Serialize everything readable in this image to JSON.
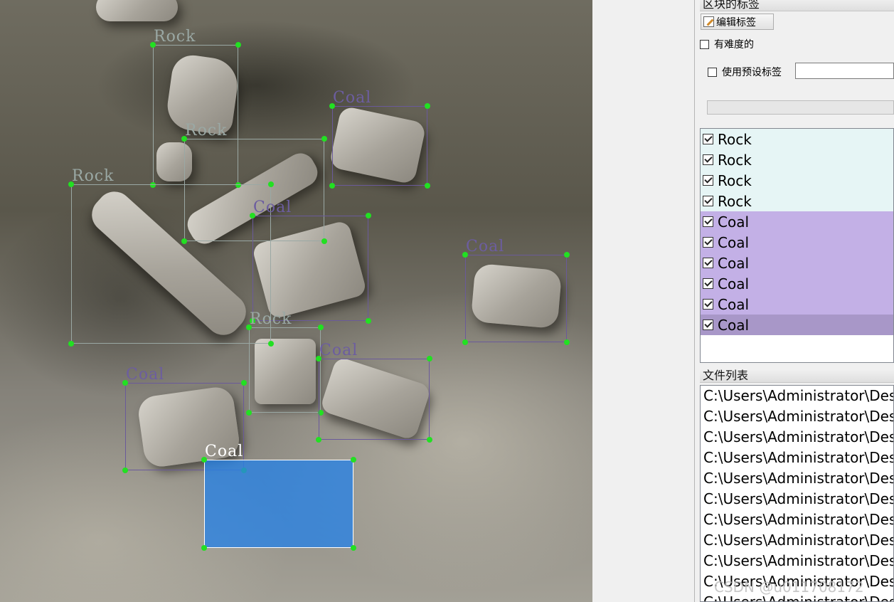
{
  "canvas": {
    "annotations": [
      {
        "label": "Rock",
        "kind": "rock",
        "selected": false
      },
      {
        "label": "Coal",
        "kind": "coal",
        "selected": false
      },
      {
        "label": "Rock",
        "kind": "rock",
        "selected": false
      },
      {
        "label": "Rock",
        "kind": "rock",
        "selected": false
      },
      {
        "label": "Coal",
        "kind": "coal",
        "selected": false
      },
      {
        "label": "Coal",
        "kind": "coal",
        "selected": false
      },
      {
        "label": "Rock",
        "kind": "rock",
        "selected": false
      },
      {
        "label": "Coal",
        "kind": "coal",
        "selected": false
      },
      {
        "label": "Coal",
        "kind": "coal",
        "selected": false
      },
      {
        "label": "Coal",
        "kind": "coal",
        "selected": true
      }
    ]
  },
  "panel": {
    "box_labels_title": "区块的标签",
    "edit_label_button": "编辑标签",
    "difficult_checkbox": "有难度的",
    "use_preset_checkbox": "使用预设标签",
    "preset_input_value": "",
    "labels": [
      {
        "text": "Rock",
        "kind": "rock",
        "checked": true,
        "selected": false
      },
      {
        "text": "Rock",
        "kind": "rock",
        "checked": true,
        "selected": false
      },
      {
        "text": "Rock",
        "kind": "rock",
        "checked": true,
        "selected": false
      },
      {
        "text": "Rock",
        "kind": "rock",
        "checked": true,
        "selected": false
      },
      {
        "text": "Coal",
        "kind": "coal",
        "checked": true,
        "selected": false
      },
      {
        "text": "Coal",
        "kind": "coal",
        "checked": true,
        "selected": false
      },
      {
        "text": "Coal",
        "kind": "coal",
        "checked": true,
        "selected": false
      },
      {
        "text": "Coal",
        "kind": "coal",
        "checked": true,
        "selected": false
      },
      {
        "text": "Coal",
        "kind": "coal",
        "checked": true,
        "selected": false
      },
      {
        "text": "Coal",
        "kind": "coal",
        "checked": true,
        "selected": true
      }
    ],
    "file_list_title": "文件列表",
    "files": [
      "C:\\Users\\Administrator\\Desk",
      "C:\\Users\\Administrator\\Desk",
      "C:\\Users\\Administrator\\Desk",
      "C:\\Users\\Administrator\\Desk",
      "C:\\Users\\Administrator\\Desk",
      "C:\\Users\\Administrator\\Desk",
      "C:\\Users\\Administrator\\Desk",
      "C:\\Users\\Administrator\\Desk",
      "C:\\Users\\Administrator\\Desk",
      "C:\\Users\\Administrator\\Desk",
      "C:\\Users\\Administrator\\Desk"
    ],
    "watermark": "CSDN @u011708172"
  },
  "colors": {
    "rock_row_bg": "#e6f5f5",
    "coal_row_bg": "#c3b0e6",
    "coal_row_selected_bg": "#a897c8",
    "rock_box": "#9aa8a4",
    "coal_box": "#6a5a9a",
    "selected_fill": "#2682e6",
    "corner_point": "#22e022"
  }
}
